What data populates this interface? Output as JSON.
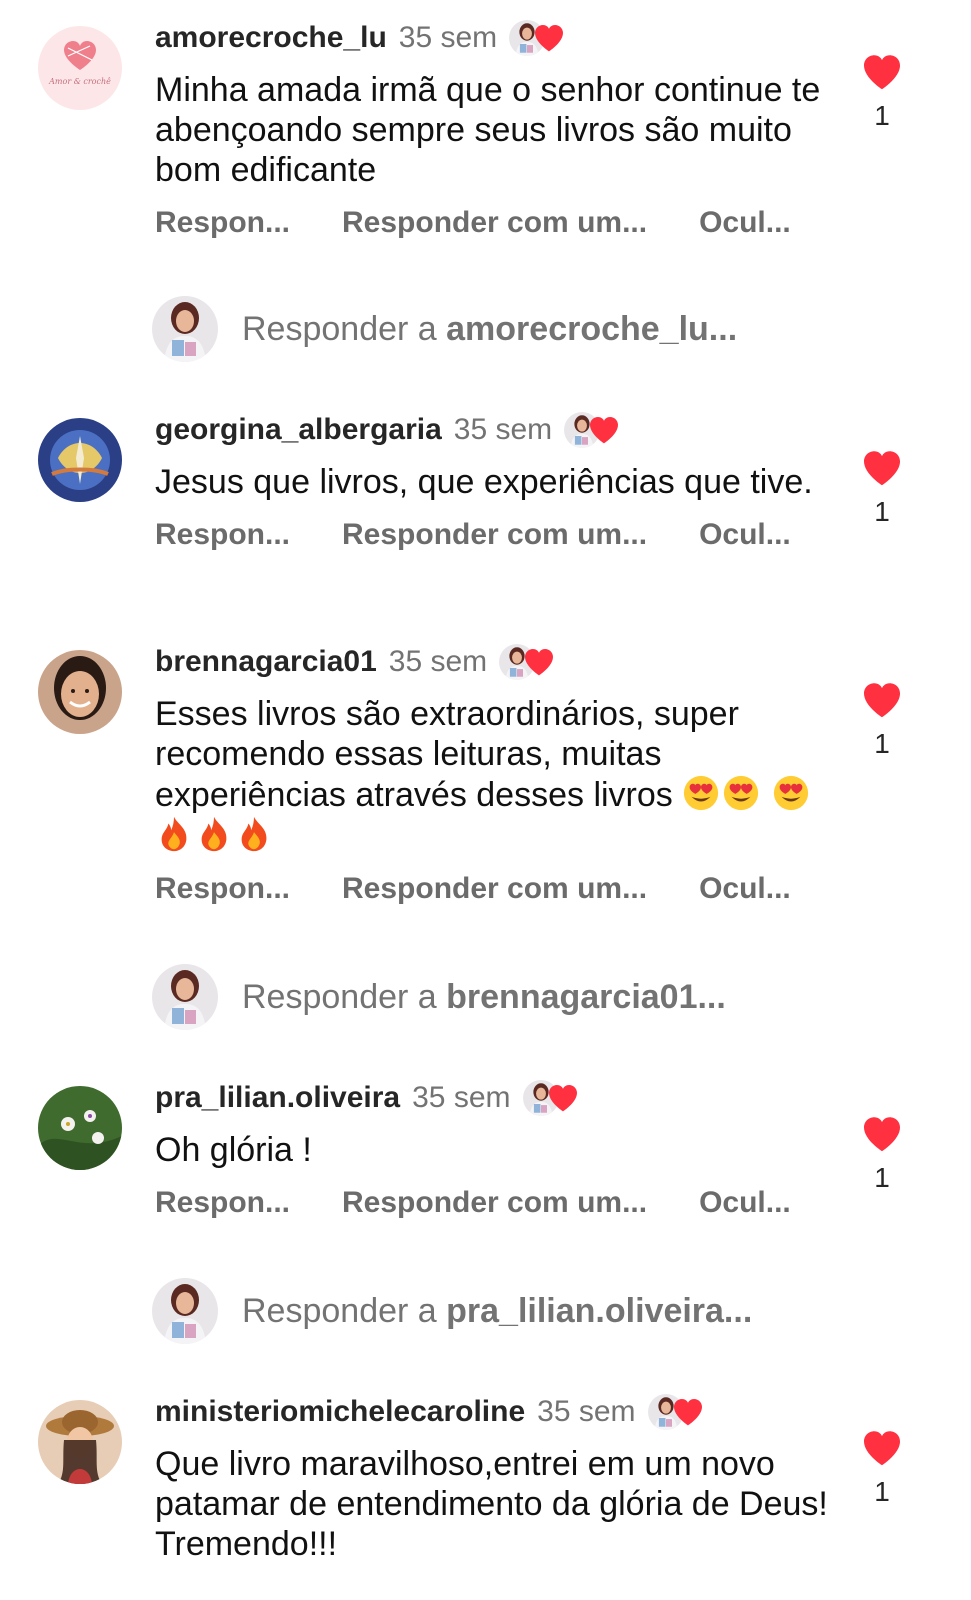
{
  "colors": {
    "like_red": "#ff3040",
    "username": "#262626",
    "muted": "#737373",
    "action": "#6b6b6b"
  },
  "icons": {
    "like": "heart-icon",
    "creator_liked": "creator-liked-heart-icon",
    "avatar": "avatar",
    "emoji_heart_eyes": "heart-eyes-emoji",
    "emoji_fire": "fire-emoji"
  },
  "comments": [
    {
      "username": "amorecroche_lu",
      "time": "35 sem",
      "text": "Minha amada irmã que o senhor continue te abençoando sempre seus livros são muito bom edificante",
      "actions": {
        "reply": "Respon...",
        "react": "Responder com um...",
        "hide": "Ocul..."
      },
      "likes": "1"
    },
    {
      "username": "georgina_albergaria",
      "time": "35 sem",
      "text": "Jesus que livros, que experiências que tive.",
      "actions": {
        "reply": "Respon...",
        "react": "Responder com um...",
        "hide": "Ocul..."
      },
      "likes": "1"
    },
    {
      "username": "brennagarcia01",
      "time": "35 sem",
      "text": "Esses livros são extraordinários, super recomendo essas leituras, muitas experiências através desses livros",
      "emojis": [
        "😍",
        "😍",
        "😍",
        "🔥",
        "🔥",
        "🔥"
      ],
      "actions": {
        "reply": "Respon...",
        "react": "Responder com um...",
        "hide": "Ocul..."
      },
      "likes": "1"
    },
    {
      "username": "pra_lilian.oliveira",
      "time": "35 sem",
      "text": "Oh glória !",
      "actions": {
        "reply": "Respon...",
        "react": "Responder com um...",
        "hide": "Ocul..."
      },
      "likes": "1"
    },
    {
      "username": "ministeriomichelecaroline",
      "time": "35 sem",
      "text": "Que livro maravilhoso,entrei em um novo patamar de entendimento da glória de Deus! Tremendo!!!",
      "likes": "1"
    }
  ],
  "reply_prompts": [
    {
      "prefix": "Responder a ",
      "user": "amorecroche_lu..."
    },
    {
      "prefix": "Responder a ",
      "user": "brennagarcia01..."
    },
    {
      "prefix": "Responder a ",
      "user": "pra_lilian.oliveira..."
    }
  ],
  "avatar_logo_text": "Amor & crochê"
}
